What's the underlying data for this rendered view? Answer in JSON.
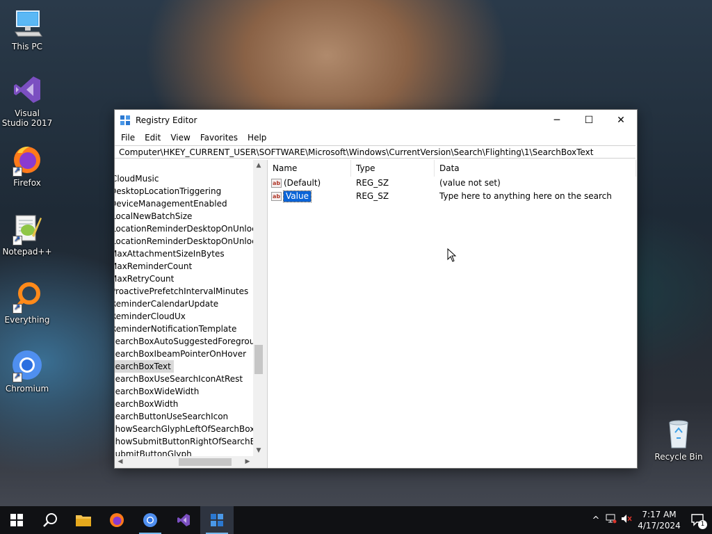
{
  "desktop": {
    "icons": [
      {
        "label": "This PC"
      },
      {
        "label": "Visual Studio 2017"
      },
      {
        "label": "Firefox"
      },
      {
        "label": "Notepad++"
      },
      {
        "label": "Everything"
      },
      {
        "label": "Chromium"
      },
      {
        "label": "Recycle Bin"
      }
    ]
  },
  "window": {
    "title": "Registry Editor",
    "controls": {
      "minimize": "─",
      "maximize": "☐",
      "close": "✕"
    },
    "menu": [
      "File",
      "Edit",
      "View",
      "Favorites",
      "Help"
    ],
    "address": "Computer\\HKEY_CURRENT_USER\\SOFTWARE\\Microsoft\\Windows\\CurrentVersion\\Search\\Flighting\\1\\SearchBoxText",
    "tree": {
      "items": [
        "CloudMusic",
        "DesktopLocationTriggering",
        "DeviceManagementEnabled",
        "LocalNewBatchSize",
        "LocationReminderDesktopOnUnlockR",
        "LocationReminderDesktopOnUnlockSp",
        "MaxAttachmentSizeInBytes",
        "MaxReminderCount",
        "MaxRetryCount",
        "ProactivePrefetchIntervalMinutes",
        "ReminderCalendarUpdate",
        "ReminderCloudUx",
        "ReminderNotificationTemplate",
        "SearchBoxAutoSuggestedForegroundC",
        "SearchBoxIbeamPointerOnHover",
        "SearchBoxText",
        "SearchBoxUseSearchIconAtRest",
        "SearchBoxWideWidth",
        "SearchBoxWidth",
        "SearchButtonUseSearchIcon",
        "ShowSearchGlyphLeftOfSearchBox",
        "ShowSubmitButtonRightOfSearchBox",
        "SubmitButtonGlyph"
      ],
      "selected": "SearchBoxText"
    },
    "list": {
      "headers": {
        "name": "Name",
        "type": "Type",
        "data": "Data"
      },
      "rows": [
        {
          "icon": "ab",
          "name": "(Default)",
          "type": "REG_SZ",
          "data": "(value not set)"
        },
        {
          "icon": "ab",
          "name": "Value",
          "type": "REG_SZ",
          "data": "Type here to anything here on the search"
        }
      ],
      "selected_row": 1
    }
  },
  "taskbar": {
    "clock": {
      "time": "7:17 AM",
      "date": "4/17/2024"
    },
    "notification_count": "1"
  },
  "colors": {
    "selection": "#0a64d7",
    "taskbar": "#101114",
    "taskbar_active": "#2e3440"
  }
}
